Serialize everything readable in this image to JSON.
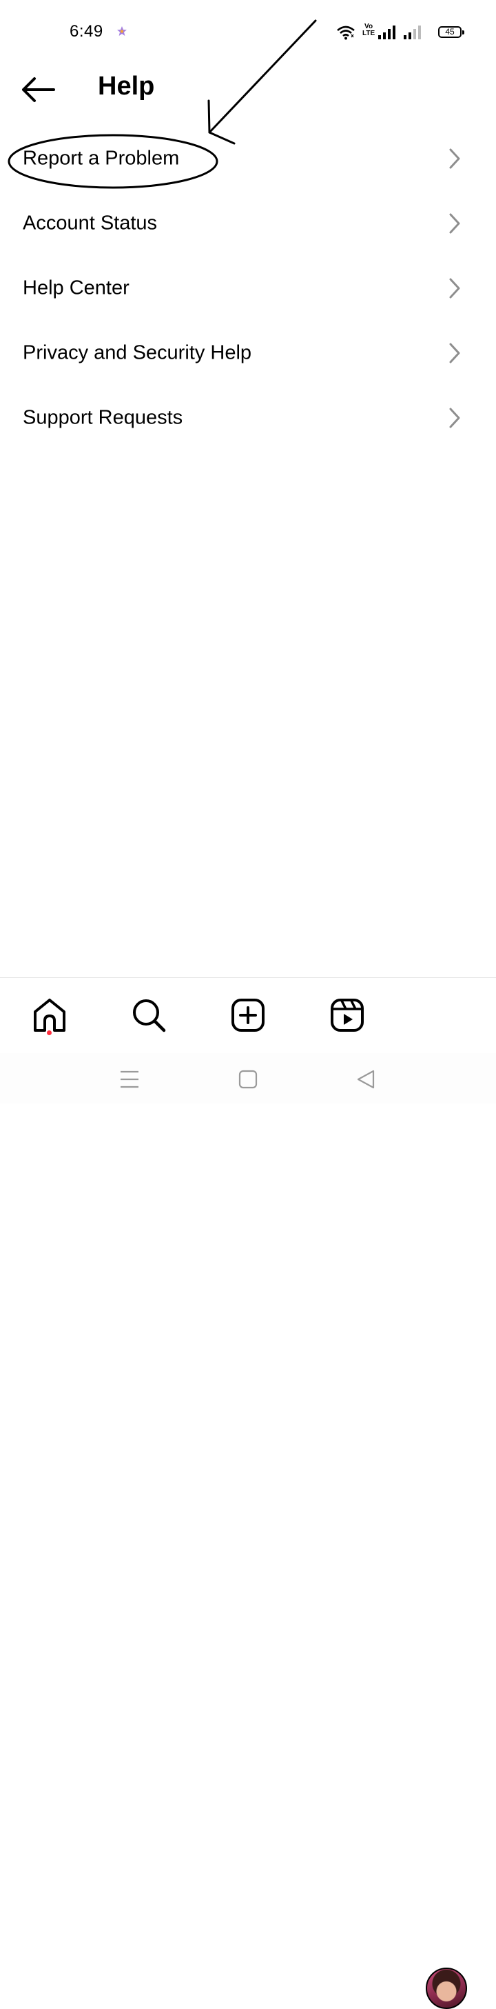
{
  "status_bar": {
    "time": "6:49",
    "volte_top": "Vo",
    "volte_bottom": "LTE",
    "battery": "45",
    "icons": [
      "star-notification-icon",
      "wifi-icon",
      "volte-icon",
      "signal-icon",
      "signal-icon",
      "battery-icon"
    ]
  },
  "header": {
    "title": "Help",
    "back_icon": "arrow-left-icon"
  },
  "menu": {
    "items": [
      {
        "label": "Report a Problem"
      },
      {
        "label": "Account Status"
      },
      {
        "label": "Help Center"
      },
      {
        "label": "Privacy and Security Help"
      },
      {
        "label": "Support Requests"
      }
    ],
    "chevron_icon": "chevron-right-icon"
  },
  "bottom_nav": {
    "items": [
      "home-icon",
      "search-icon",
      "create-icon",
      "reels-icon",
      "profile-avatar"
    ],
    "active": "home-icon"
  },
  "system_nav": {
    "items": [
      "menu-icon",
      "home-square-icon",
      "back-triangle-icon"
    ]
  },
  "colors": {
    "background": "#ffffff",
    "text": "#000000",
    "chevron": "#8e8e8e",
    "notification_dot": "#ff3040"
  }
}
